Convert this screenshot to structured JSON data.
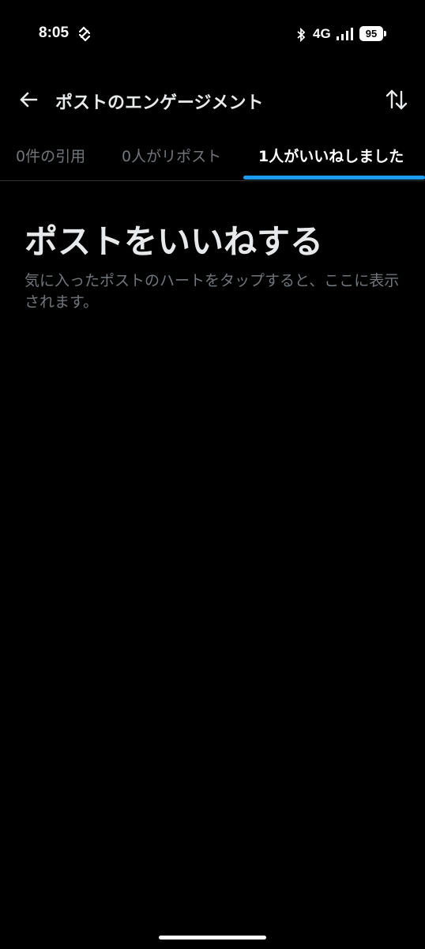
{
  "status_bar": {
    "time": "8:05",
    "network": "4G",
    "battery": "95",
    "icons": [
      "sync-icon",
      "bluetooth-icon",
      "signal-icon",
      "battery-icon"
    ]
  },
  "header": {
    "title": "ポストのエンゲージメント",
    "back_icon": "arrow-left-icon",
    "sort_icon": "sort-arrows-icon"
  },
  "tabs": [
    {
      "label": "0件の引用",
      "active": false
    },
    {
      "label": "0人がリポスト",
      "active": false
    },
    {
      "label": "1人がいいねしました",
      "active": true
    }
  ],
  "empty_state": {
    "title": "ポストをいいねする",
    "description": "気に入ったポストのハートをタップすると、ここに表示されます。"
  },
  "colors": {
    "background": "#000000",
    "accent": "#1d9bf0",
    "muted_text": "#71767b",
    "primary_text": "#e7e9ea"
  }
}
